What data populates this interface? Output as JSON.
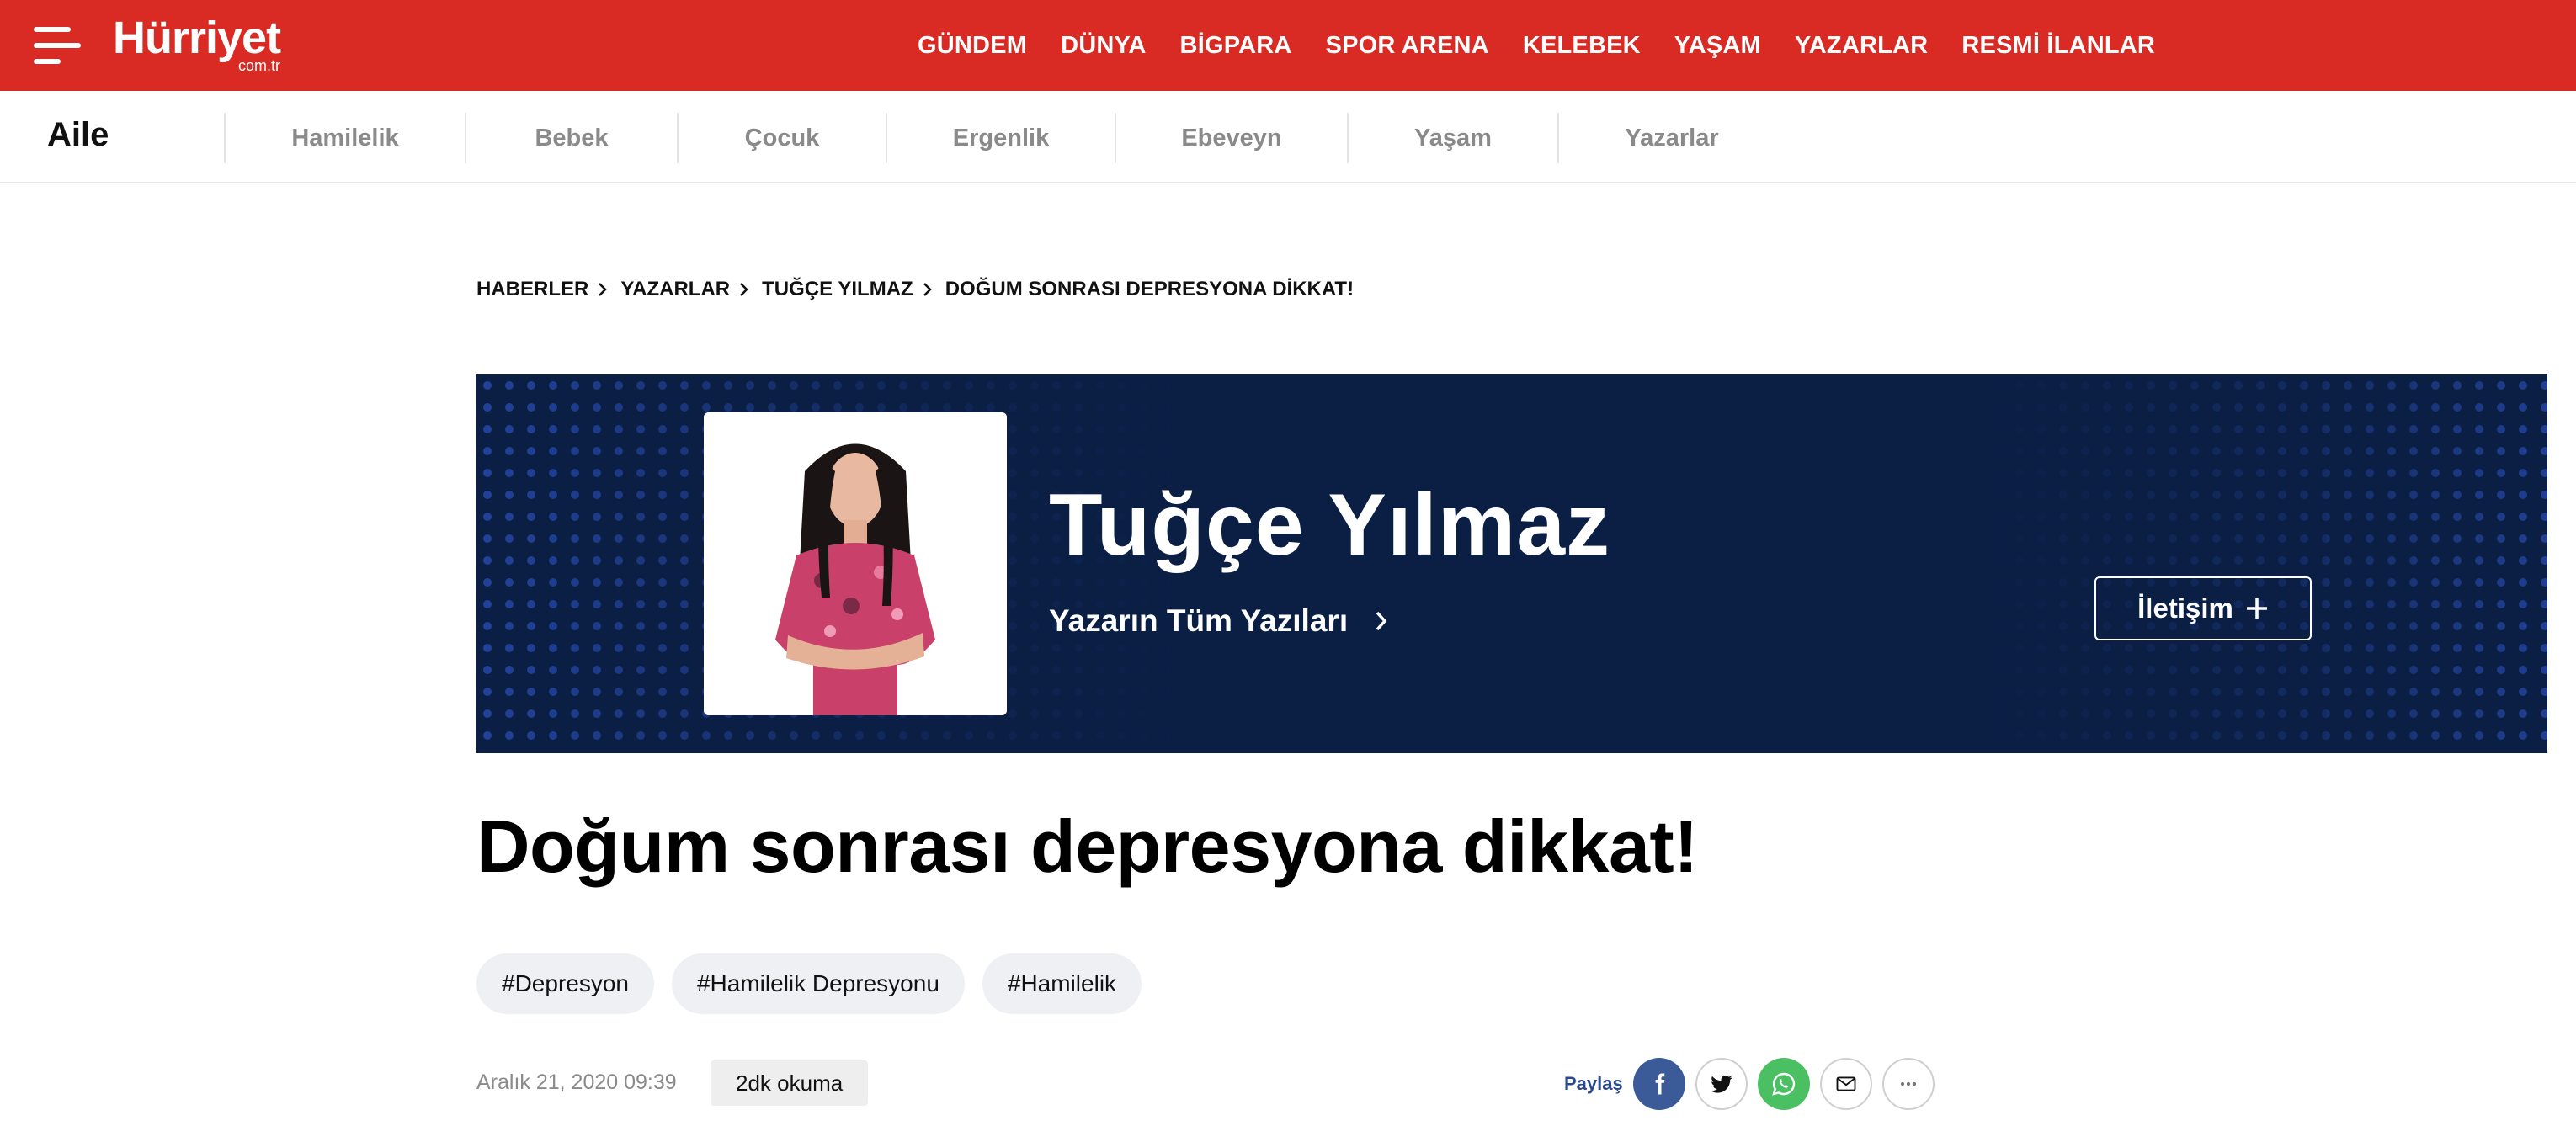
{
  "header": {
    "logo_main": "Hürriyet",
    "logo_sub": "com.tr",
    "nav": [
      "GÜNDEM",
      "DÜNYA",
      "BİGPARA",
      "SPOR ARENA",
      "KELEBEK",
      "YAŞAM",
      "YAZARLAR",
      "RESMİ İLANLAR"
    ]
  },
  "subnav": {
    "section": "Aile",
    "items": [
      "Hamilelik",
      "Bebek",
      "Çocuk",
      "Ergenlik",
      "Ebeveyn",
      "Yaşam",
      "Yazarlar"
    ]
  },
  "breadcrumb": [
    "HABERLER",
    "YAZARLAR",
    "TUĞÇE YILMAZ",
    "DOĞUM SONRASI DEPRESYONA DİKKAT!"
  ],
  "author": {
    "name": "Tuğçe Yılmaz",
    "all_posts_label": "Yazarın Tüm Yazıları",
    "contact_label": "İletişim"
  },
  "article": {
    "title": "Doğum sonrası depresyona dikkat!",
    "tags": [
      "#Depresyon",
      "#Hamilelik Depresyonu",
      "#Hamilelik"
    ],
    "date": "Aralık 21, 2020 09:39",
    "read_time": "2dk okuma"
  },
  "share": {
    "label": "Paylaş",
    "buttons": [
      "facebook-icon",
      "twitter-icon",
      "whatsapp-icon",
      "mail-icon",
      "more-icon"
    ]
  },
  "colors": {
    "brand_red": "#da2a24",
    "banner_navy": "#0b1f44",
    "facebook_blue": "#3b5b98",
    "whatsapp_green": "#4bc062",
    "share_label_blue": "#2b4a8c"
  }
}
